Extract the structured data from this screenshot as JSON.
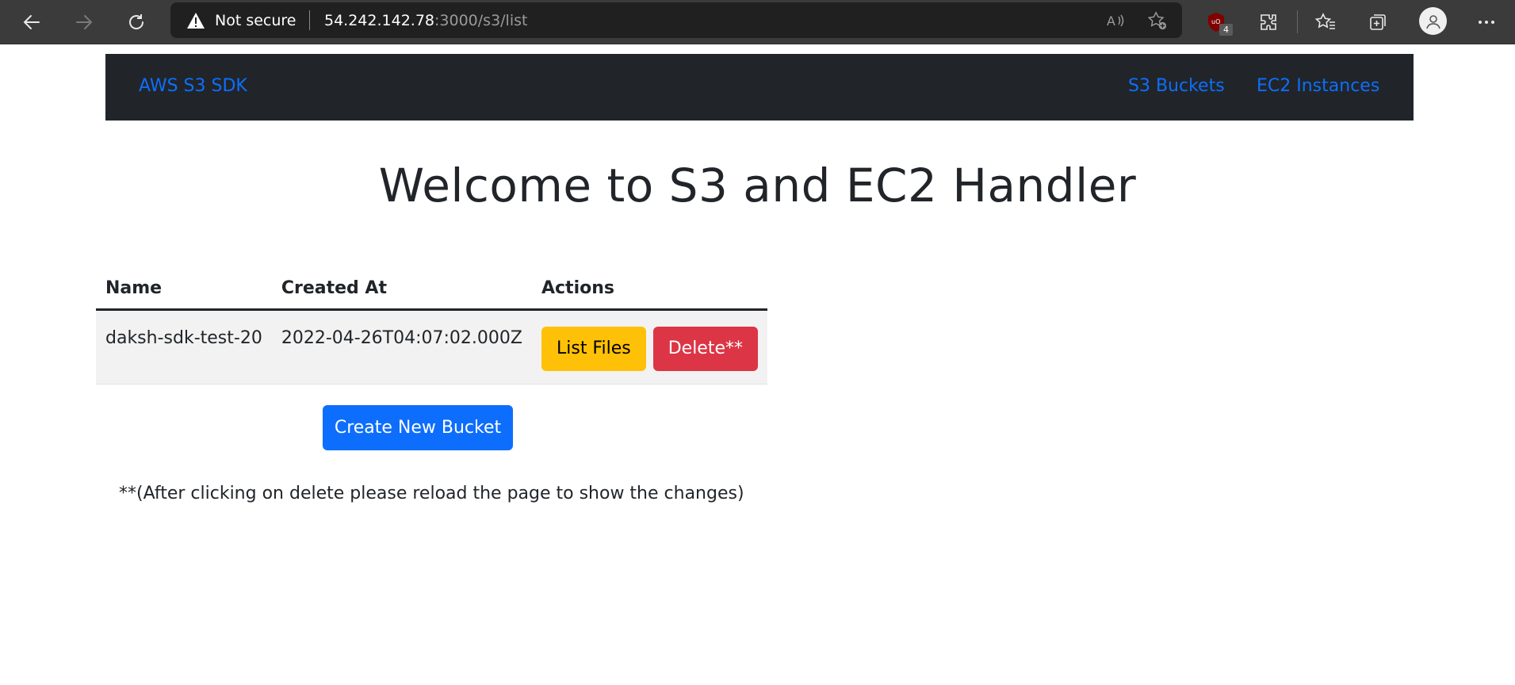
{
  "browser": {
    "not_secure_label": "Not secure",
    "url_host": "54.242.142.78",
    "url_path": ":3000/s3/list",
    "ublock_count": "4",
    "icons": [
      "back-icon",
      "forward-icon",
      "refresh-icon",
      "warning-icon",
      "read-aloud-icon",
      "add-favorite-icon",
      "ublock-icon",
      "extensions-icon",
      "favorites-icon",
      "collections-icon",
      "profile-icon",
      "more-icon"
    ]
  },
  "navbar": {
    "brand": "AWS S3 SDK",
    "links": [
      "S3 Buckets",
      "EC2 Instances"
    ]
  },
  "main": {
    "title": "Welcome to S3 and EC2 Handler",
    "table": {
      "columns": [
        "Name",
        "Created At",
        "Actions"
      ],
      "rows": [
        {
          "name": "daksh-sdk-test-20",
          "created_at": "2022-04-26T04:07:02.000Z",
          "list_label": "List Files",
          "delete_label": "Delete**"
        }
      ]
    },
    "create_button": "Create New Bucket",
    "note": "**(After clicking on delete please reload the page to show the changes)"
  },
  "colors": {
    "navbar_bg": "#212529",
    "link": "#0d6efd",
    "warning_button": "#ffc107",
    "danger_button": "#dc3545",
    "primary_button": "#0d6efd"
  }
}
